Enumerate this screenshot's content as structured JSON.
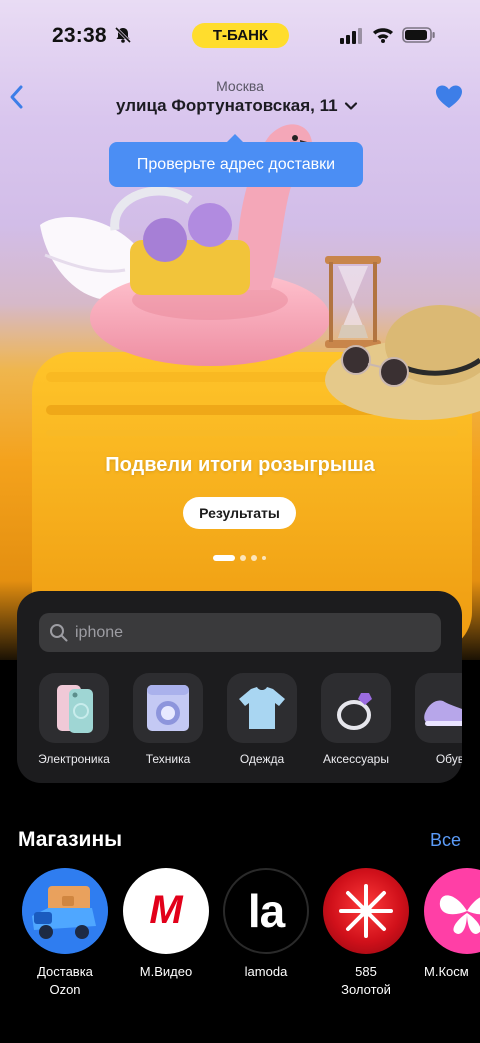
{
  "status_bar": {
    "time": "23:38",
    "carrier_badge": "Т-БАНК",
    "icons": [
      "bell-muted-icon",
      "signal-icon",
      "wifi-icon",
      "battery-icon"
    ],
    "badge_color": "#ffdd2d"
  },
  "header": {
    "city": "Москва",
    "address": "улица Фортунатовская, 11",
    "tooltip": "Проверьте адрес доставки",
    "tooltip_color": "#4b8ef4"
  },
  "banner": {
    "title": "Подвели итоги розыгрыша",
    "button": "Результаты",
    "active_slide": 1,
    "slide_count": 4
  },
  "search": {
    "placeholder": "iphone"
  },
  "categories": [
    {
      "label": "Электроника",
      "icon": "phone-icon"
    },
    {
      "label": "Техника",
      "icon": "washing-machine-icon"
    },
    {
      "label": "Одежда",
      "icon": "tshirt-icon"
    },
    {
      "label": "Аксессуары",
      "icon": "ring-icon"
    },
    {
      "label": "Обув",
      "icon": "sneaker-icon"
    }
  ],
  "stores": {
    "title": "Магазины",
    "all_link": "Все",
    "link_color": "#5b9bf7",
    "items": [
      {
        "label": "Доставка\nOzon",
        "icon": "delivery-truck-icon"
      },
      {
        "label": "М.Видео",
        "logo_text": "М",
        "icon": "mvideo-logo"
      },
      {
        "label": "lamoda",
        "logo_text": "la",
        "icon": "lamoda-logo"
      },
      {
        "label": "585\nЗолотой",
        "icon": "585-zolotoy-logo"
      },
      {
        "label": "М.Косм",
        "icon": "butterfly-logo"
      }
    ]
  }
}
